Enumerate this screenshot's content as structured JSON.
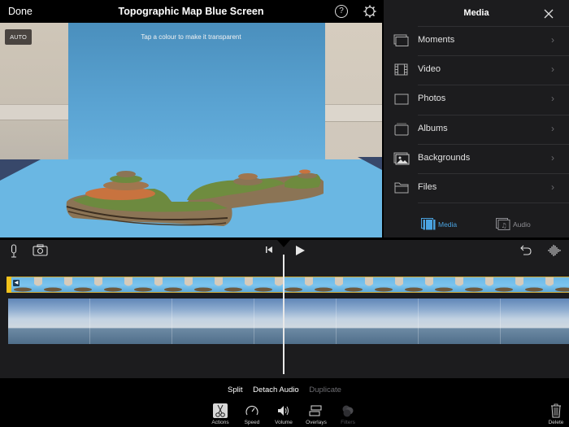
{
  "header": {
    "done_label": "Done",
    "title": "Topographic Map Blue Screen",
    "help_icon": "?",
    "settings_icon": "gear-icon"
  },
  "viewer": {
    "auto_label": "AUTO",
    "hint": "Tap a colour to make it transparent"
  },
  "media_panel": {
    "title": "Media",
    "close_icon": "close-icon",
    "items": [
      {
        "label": "Moments",
        "icon": "moments-icon"
      },
      {
        "label": "Video",
        "icon": "film-icon"
      },
      {
        "label": "Photos",
        "icon": "photo-frame-icon"
      },
      {
        "label": "Albums",
        "icon": "albums-icon"
      },
      {
        "label": "Backgrounds",
        "icon": "landscape-icon"
      },
      {
        "label": "Files",
        "icon": "folder-icon"
      }
    ],
    "tabs": [
      {
        "label": "Media",
        "active": true
      },
      {
        "label": "Audio",
        "active": false
      }
    ],
    "accent_color": "#4aa3e0"
  },
  "timeline": {
    "left_tools": [
      "microphone-icon",
      "camera-icon"
    ],
    "transport": [
      "skip-to-start-icon",
      "play-icon"
    ],
    "right_tools": [
      "undo-icon",
      "audio-waveform-icon"
    ],
    "overlay_clip_color": "#f2c21b"
  },
  "bottom": {
    "actions": [
      {
        "label": "Split",
        "enabled": true
      },
      {
        "label": "Detach Audio",
        "enabled": true
      },
      {
        "label": "Duplicate",
        "enabled": false
      }
    ],
    "tools": [
      {
        "label": "Actions",
        "active": true
      },
      {
        "label": "Speed",
        "active": false
      },
      {
        "label": "Volume",
        "active": false
      },
      {
        "label": "Overlays",
        "active": false
      },
      {
        "label": "Filters",
        "disabled": true
      }
    ],
    "delete_label": "Delete"
  }
}
